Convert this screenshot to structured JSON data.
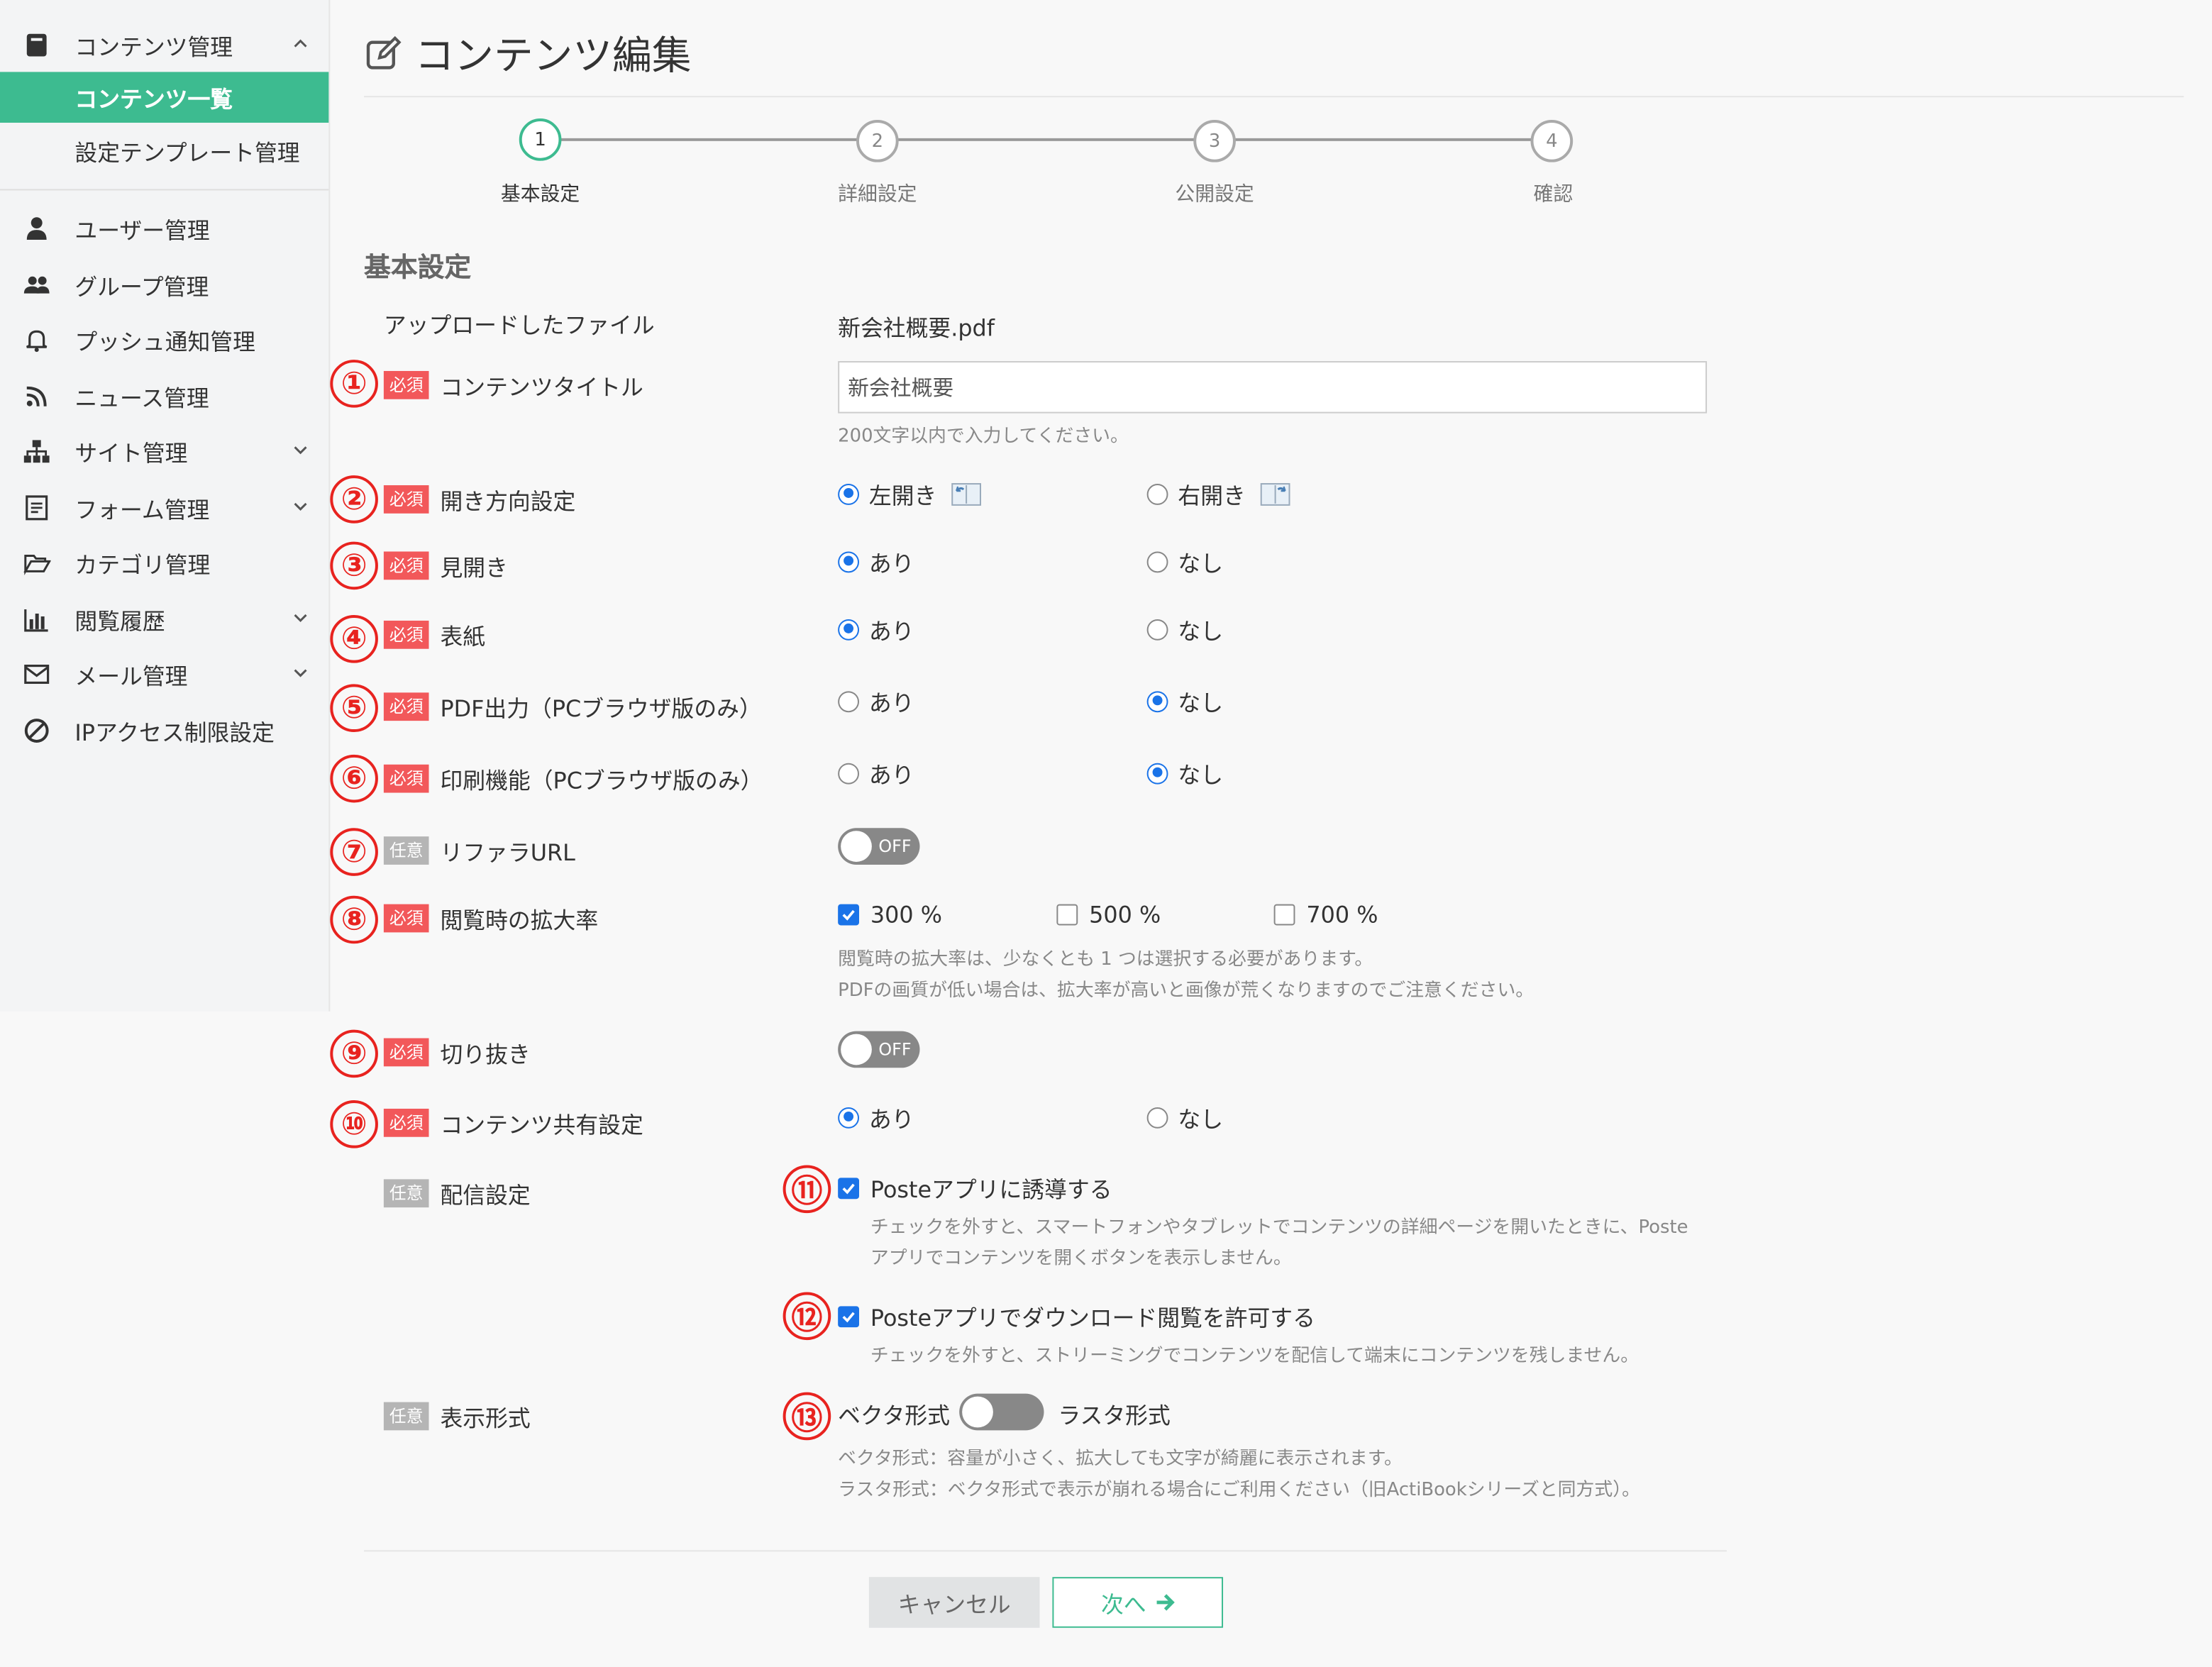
{
  "sidebar": {
    "group_label": "コンテンツ管理",
    "sub_items": [
      {
        "label": "コンテンツ一覧"
      },
      {
        "label": "設定テンプレート管理"
      }
    ],
    "items": [
      {
        "label": "ユーザー管理",
        "icon": "user-icon"
      },
      {
        "label": "グループ管理",
        "icon": "users-icon"
      },
      {
        "label": "プッシュ通知管理",
        "icon": "bell-icon"
      },
      {
        "label": "ニュース管理",
        "icon": "rss-icon"
      },
      {
        "label": "サイト管理",
        "icon": "sitemap-icon"
      },
      {
        "label": "フォーム管理",
        "icon": "form-icon"
      },
      {
        "label": "カテゴリ管理",
        "icon": "folder-open-icon"
      },
      {
        "label": "閲覧履歴",
        "icon": "bar-chart-icon"
      },
      {
        "label": "メール管理",
        "icon": "envelope-icon"
      },
      {
        "label": "IPアクセス制限設定",
        "icon": "ban-icon"
      }
    ]
  },
  "page": {
    "title": "コンテンツ編集",
    "steps": [
      {
        "num": "1",
        "label": "基本設定"
      },
      {
        "num": "2",
        "label": "詳細設定"
      },
      {
        "num": "3",
        "label": "公開設定"
      },
      {
        "num": "4",
        "label": "確認"
      }
    ],
    "section_title": "基本設定"
  },
  "badges": {
    "required": "必須",
    "optional": "任意"
  },
  "markers": [
    "①",
    "②",
    "③",
    "④",
    "⑤",
    "⑥",
    "⑦",
    "⑧",
    "⑨",
    "⑩",
    "⑪",
    "⑫",
    "⑬"
  ],
  "form": {
    "uploaded_label": "アップロードしたファイル",
    "uploaded_value": "新会社概要.pdf",
    "title_label": "コンテンツタイトル",
    "title_value": "新会社概要",
    "title_help": "200文字以内で入力してください。",
    "direction_label": "開き方向設定",
    "direction_left": "左開き",
    "direction_right": "右開き",
    "spread_label": "見開き",
    "cover_label": "表紙",
    "pdf_label": "PDF出力（PCブラウザ版のみ）",
    "print_label": "印刷機能（PCブラウザ版のみ）",
    "yes": "あり",
    "no": "なし",
    "referrer_label": "リファラURL",
    "off": "OFF",
    "zoom_label": "閲覧時の拡大率",
    "zoom_options": [
      "300 %",
      "500 %",
      "700 %"
    ],
    "zoom_help1": "閲覧時の拡大率は、少なくとも 1 つは選択する必要があります。",
    "zoom_help2": "PDFの画質が低い場合は、拡大率が高いと画像が荒くなりますのでご注意ください。",
    "crop_label": "切り抜き",
    "share_label": "コンテンツ共有設定",
    "delivery_label": "配信設定",
    "poste_guide": "Posteアプリに誘導する",
    "poste_guide_help1": "チェックを外すと、スマートフォンやタブレットでコンテンツの詳細ページを開いたときに、Poste",
    "poste_guide_help2": "アプリでコンテンツを開くボタンを表示しません。",
    "poste_download": "Posteアプリでダウンロード閲覧を許可する",
    "poste_download_help": "チェックを外すと、ストリーミングでコンテンツを配信して端末にコンテンツを残しません。",
    "display_label": "表示形式",
    "vector": "ベクタ形式",
    "raster": "ラスタ形式",
    "display_help1": "ベクタ形式：容量が小さく、拡大しても文字が綺麗に表示されます。",
    "display_help2": "ラスタ形式：ベクタ形式で表示が崩れる場合にご利用ください（旧ActiBookシリーズと同方式）。"
  },
  "buttons": {
    "cancel": "キャンセル",
    "next": "次へ"
  },
  "colors": {
    "accent": "#3dbb90",
    "required": "#f2585a",
    "marker": "#e8231f",
    "radio": "#1a73e8"
  }
}
